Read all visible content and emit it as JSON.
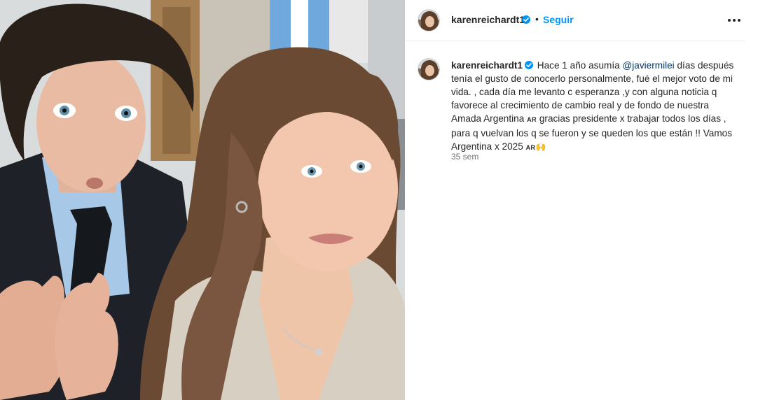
{
  "post": {
    "username": "karenreichardt1",
    "follow_label": "Seguir",
    "separator": "•",
    "caption": {
      "part1": "Hace 1 año asumía ",
      "mention": "@javiermilei",
      "part2": " días después tenía el gusto de conocerlo personalmente, fué el mejor voto de mi vida. , cada día me levanto c esperanza ,y con alguna noticia q favorece al crecimiento de cambio real y de fondo de nuestra Amada Argentina ",
      "flag1": "AR",
      "part3": " gracias presidente x trabajar todos los días , para q vuelvan los q se fueron y se queden los que están !! Vamos Argentina x 2025 ",
      "flag2": "AR",
      "emoji": "🙌"
    },
    "timestamp": "35 sem"
  },
  "icons": {
    "verified": "verified-badge-icon",
    "more": "more-options-icon"
  },
  "colors": {
    "accent": "#0095f6",
    "mention": "#00376b",
    "muted": "#737373"
  }
}
